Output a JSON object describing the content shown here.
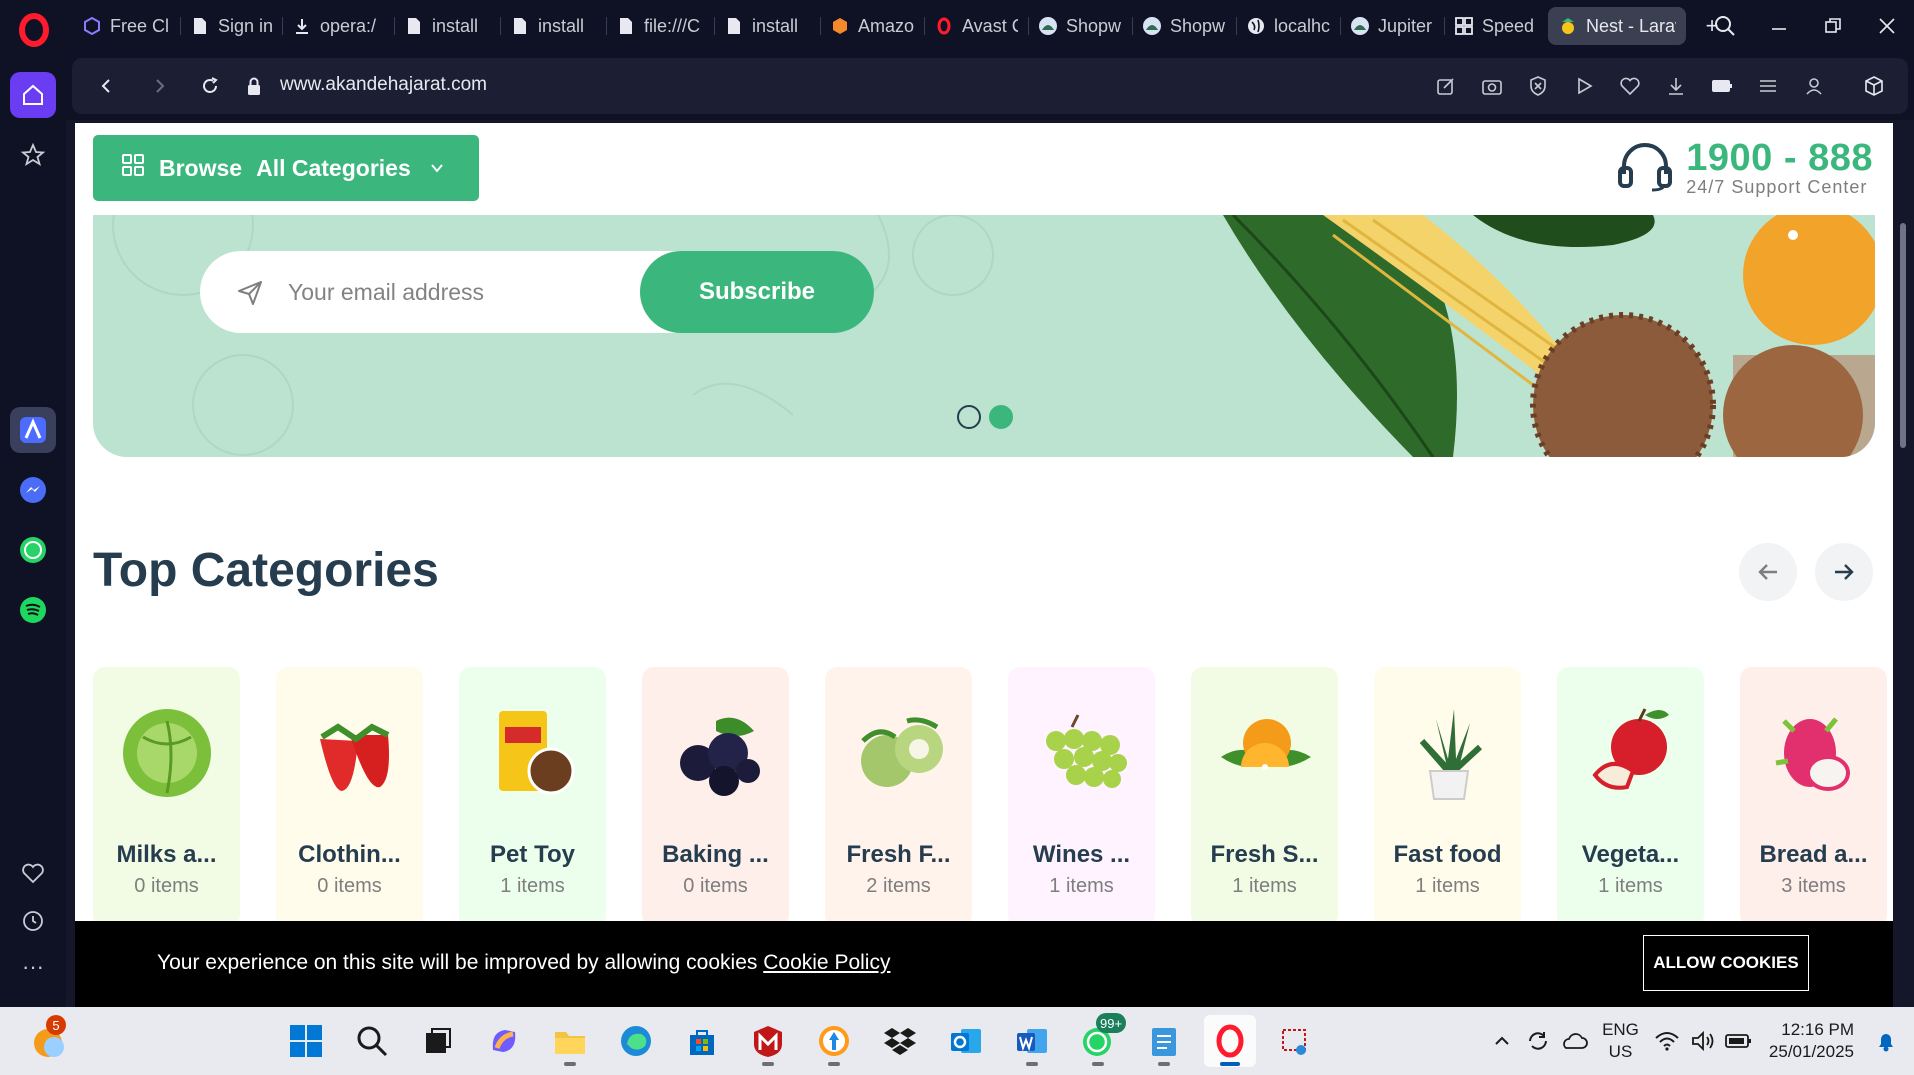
{
  "browser": {
    "tabs": [
      {
        "title": "Free Cl",
        "icon": "cube-icon"
      },
      {
        "title": "Sign in",
        "icon": "page-icon"
      },
      {
        "title": "opera:/",
        "icon": "download-icon"
      },
      {
        "title": "install",
        "icon": "page-icon"
      },
      {
        "title": "install",
        "icon": "page-icon"
      },
      {
        "title": "file:///C",
        "icon": "page-icon"
      },
      {
        "title": "install",
        "icon": "page-icon"
      },
      {
        "title": "Amazo",
        "icon": "aws-icon"
      },
      {
        "title": "Avast C",
        "icon": "opera-icon"
      },
      {
        "title": "Shopw",
        "icon": "shopware-icon"
      },
      {
        "title": "Shopw",
        "icon": "shopware-icon"
      },
      {
        "title": "localhc",
        "icon": "globe-icon"
      },
      {
        "title": "Jupiter",
        "icon": "shopware-icon"
      },
      {
        "title": "Speed",
        "icon": "grid-icon"
      },
      {
        "title": "Nest - Larave",
        "icon": "nest-icon",
        "active": true
      }
    ],
    "url": "www.akandehajarat.com"
  },
  "page": {
    "browse_label": "Browse",
    "browse_label2": "All Categories",
    "support_phone": "1900 - 888",
    "support_text": "24/7 Support Center",
    "newsletter": {
      "placeholder": "Your email address",
      "subscribe_label": "Subscribe"
    },
    "section_title": "Top Categories",
    "categories": [
      {
        "name": "Milks a...",
        "count": "0 items",
        "bg": "#f2fce4",
        "icon": "cabbage-icon"
      },
      {
        "name": "Clothin...",
        "count": "0 items",
        "bg": "#fffceb",
        "icon": "strawberry-icon"
      },
      {
        "name": "Pet Toy",
        "count": "1 items",
        "bg": "#ecffec",
        "icon": "snack-pack-icon"
      },
      {
        "name": "Baking ...",
        "count": "0 items",
        "bg": "#feefea",
        "icon": "blackberry-icon"
      },
      {
        "name": "Fresh F...",
        "count": "2 items",
        "bg": "#fff3eb",
        "icon": "custard-apple-icon"
      },
      {
        "name": "Wines ...",
        "count": "1 items",
        "bg": "#fff3ff",
        "icon": "grapes-icon"
      },
      {
        "name": "Fresh S...",
        "count": "1 items",
        "bg": "#f2fce4",
        "icon": "orange-icon"
      },
      {
        "name": "Fast food",
        "count": "1 items",
        "bg": "#fffceb",
        "icon": "plant-icon"
      },
      {
        "name": "Vegeta...",
        "count": "1 items",
        "bg": "#ecffec",
        "icon": "apple-icon"
      },
      {
        "name": "Bread a...",
        "count": "3 items",
        "bg": "#feefea",
        "icon": "dragon-fruit-icon"
      }
    ],
    "cookie": {
      "text": "Your experience on this site will be improved by allowing cookies",
      "link": "Cookie Policy",
      "button": "ALLOW COOKIES"
    }
  },
  "taskbar": {
    "notification_badge": "5",
    "whatsapp_badge": "99+",
    "lang_line1": "ENG",
    "lang_line2": "US",
    "time": "12:16 PM",
    "date": "25/01/2025"
  },
  "colors": {
    "accent": "#3bb77e",
    "heading": "#253d4e",
    "banner": "#bce3d0",
    "browser_bg": "#0f1224"
  }
}
